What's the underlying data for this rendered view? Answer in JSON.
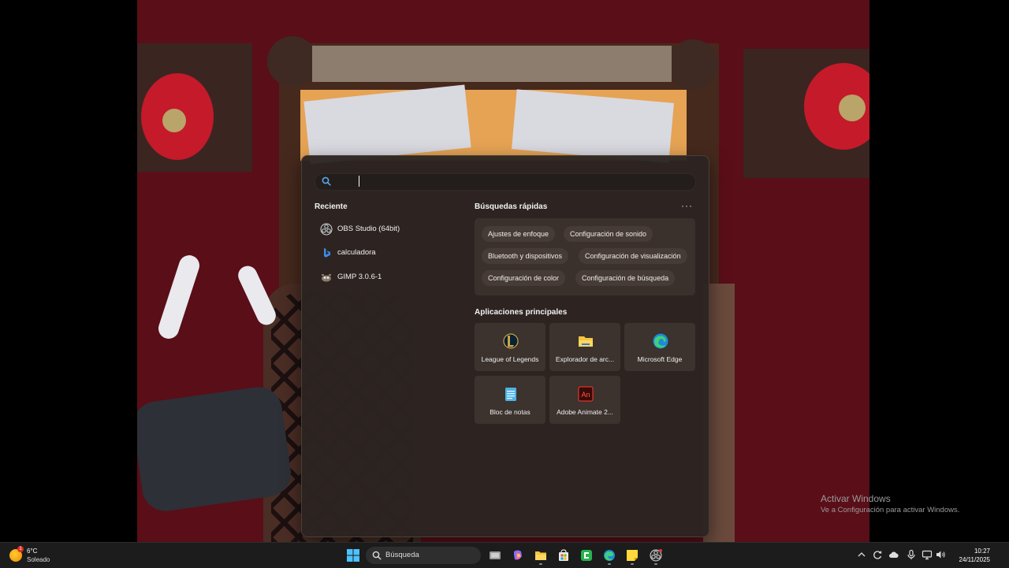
{
  "start_panel": {
    "search_value": "",
    "recent": {
      "title": "Reciente",
      "items": [
        {
          "label": "OBS Studio (64bit)",
          "icon": "obs-icon"
        },
        {
          "label": "calculadora",
          "icon": "bing-icon"
        },
        {
          "label": "GIMP 3.0.6-1",
          "icon": "gimp-icon"
        }
      ]
    },
    "quick_searches": {
      "title": "Búsquedas rápidas",
      "more": "···",
      "chips": [
        "Ajustes de enfoque",
        "Configuración de sonido",
        "Bluetooth y dispositivos",
        "Configuración de visualización",
        "Configuración de color",
        "Configuración de búsqueda"
      ]
    },
    "top_apps": {
      "title": "Aplicaciones principales",
      "apps": [
        {
          "label": "League of Legends",
          "icon": "league-of-legends-icon"
        },
        {
          "label": "Explorador de arc...",
          "icon": "file-explorer-icon"
        },
        {
          "label": "Microsoft Edge",
          "icon": "edge-icon"
        },
        {
          "label": "Bloc de notas",
          "icon": "notepad-icon"
        },
        {
          "label": "Adobe Animate 2...",
          "icon": "adobe-animate-icon"
        }
      ]
    }
  },
  "watermark": {
    "line1": "Activar Windows",
    "line2": "Ve a Configuración para activar Windows."
  },
  "taskbar": {
    "weather": {
      "temperature": "6°C",
      "condition": "Soleado",
      "badge": "1"
    },
    "search_label": "Búsqueda",
    "clock": {
      "time": "10:27",
      "date": "24/11/2025"
    }
  },
  "colors": {
    "panel_bg": "#2c2421",
    "chip_bg": "#463b36",
    "tile_bg": "#3c322e",
    "taskbar_bg": "#1c1c1c",
    "accent": "#3b8ced"
  }
}
